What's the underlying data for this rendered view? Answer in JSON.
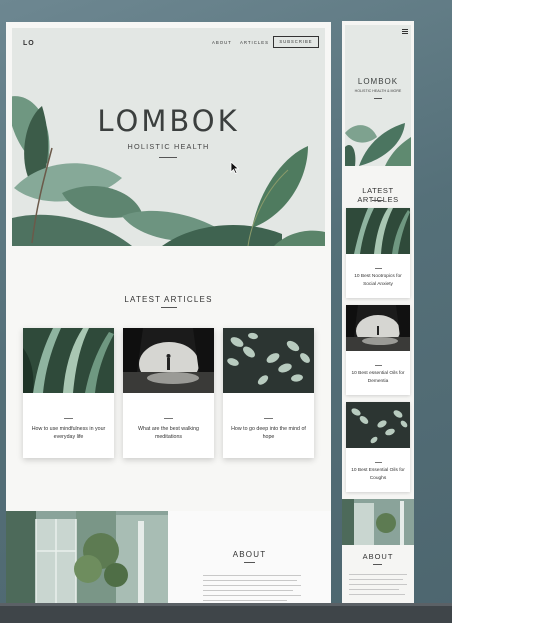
{
  "desktop": {
    "logo": "LO",
    "nav": [
      "ABOUT",
      "ARTICLES"
    ],
    "subscribe_label": "SUBSCRIBE",
    "hero_title": "LOMBOK",
    "hero_subtitle": "HOLISTIC HEALTH",
    "latest_title": "LATEST ARTICLES",
    "articles": [
      {
        "title": "How to use mindfulness in your everyday life"
      },
      {
        "title": "What are the best walking meditations"
      },
      {
        "title": "How to go deep into the mind of hope"
      }
    ],
    "about_title": "ABOUT"
  },
  "mobile": {
    "menu_icon": "hamburger-icon",
    "hero_title": "LOMBOK",
    "hero_subtitle": "HOLISTIC HEALTH & MORE",
    "latest_title": "LATEST ARTICLES",
    "articles": [
      {
        "title": "10 Best Nootropics for Social Anxiety"
      },
      {
        "title": "10 Best essential Oils for Dementia"
      },
      {
        "title": "10 Best Essential Oils for Coughs"
      }
    ],
    "about_title": "ABOUT"
  },
  "colors": {
    "background": "#557079",
    "hero_bg": "#e3e7e4",
    "leaf": "#5f8a72",
    "text_dark": "#3b3f3e"
  }
}
